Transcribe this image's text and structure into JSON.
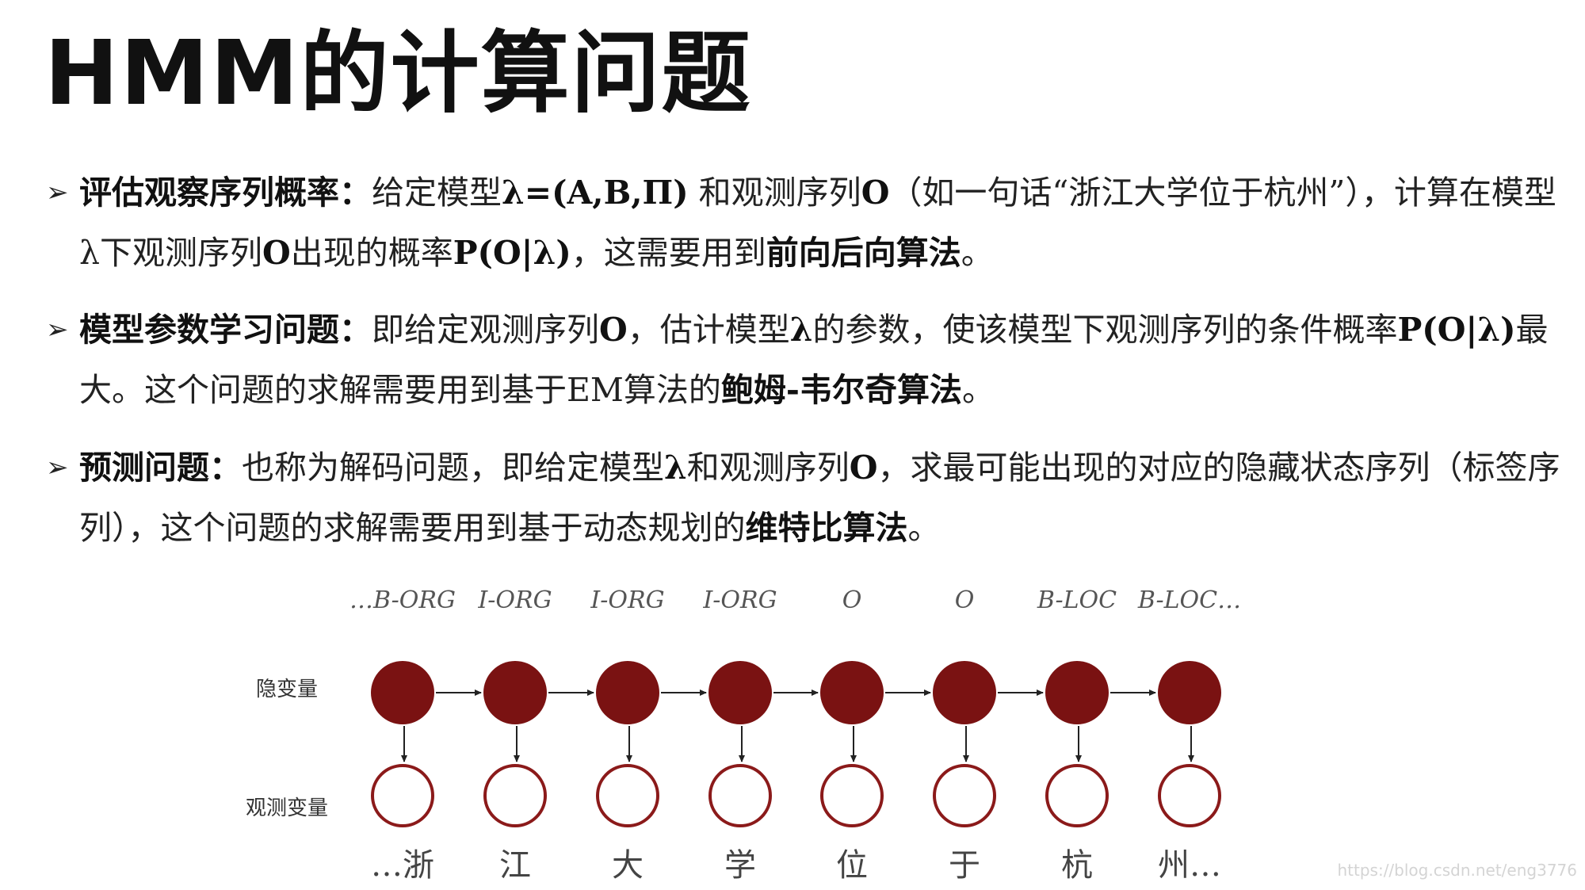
{
  "title": "HMM的计算问题",
  "bullets": [
    {
      "head": "评估观察序列概率：",
      "parts": [
        {
          "t": "给定模型",
          "bold": false
        },
        {
          "t": "λ=(A,B,Π)",
          "bold": true
        },
        {
          "t": " 和观测序列",
          "bold": false
        },
        {
          "t": "O",
          "bold": true
        },
        {
          "t": "（如一句话“浙江大学位于杭州”），计算在模型",
          "bold": false
        },
        {
          "t": "λ",
          "bold": false
        },
        {
          "t": "下观测序列",
          "bold": false
        },
        {
          "t": "O",
          "bold": true
        },
        {
          "t": "出现的概率",
          "bold": false
        },
        {
          "t": "P(O|λ)",
          "bold": true
        },
        {
          "t": "，这需要用到",
          "bold": false
        },
        {
          "t": "前向后向算法",
          "bold": true
        },
        {
          "t": "。",
          "bold": false
        }
      ]
    },
    {
      "head": "模型参数学习问题：",
      "parts": [
        {
          "t": "即给定观测序列",
          "bold": false
        },
        {
          "t": "O",
          "bold": true
        },
        {
          "t": "，估计模型",
          "bold": false
        },
        {
          "t": "λ",
          "bold": true
        },
        {
          "t": "的参数，使该模型下观测序列的条件概率",
          "bold": false
        },
        {
          "t": "P(O|λ)",
          "bold": true
        },
        {
          "t": "最大。这个问题的求解需要用到基于EM算法的",
          "bold": false
        },
        {
          "t": "鲍姆-韦尔奇算法",
          "bold": true
        },
        {
          "t": "。",
          "bold": false
        }
      ]
    },
    {
      "head": "预测问题：",
      "parts": [
        {
          "t": "也称为解码问题，即给定模型",
          "bold": false
        },
        {
          "t": "λ",
          "bold": true
        },
        {
          "t": "和观测序列",
          "bold": false
        },
        {
          "t": "O",
          "bold": true
        },
        {
          "t": "，求最可能出现的对应的隐藏状态序列（标签序列），这个问题的求解需要用到基于动态规划的",
          "bold": false
        },
        {
          "t": "维特比算法",
          "bold": true
        },
        {
          "t": "。",
          "bold": false
        }
      ]
    }
  ],
  "diagram": {
    "hidden_label": "隐变量",
    "observed_label": "观测变量",
    "tags": [
      "…B-ORG",
      "I-ORG",
      "I-ORG",
      "I-ORG",
      "O",
      "O",
      "B-LOC",
      "B-LOC…"
    ],
    "chars": [
      "…浙",
      "江",
      "大",
      "学",
      "位",
      "于",
      "杭",
      "州…"
    ],
    "hidden_color": "#7a1212",
    "observed_stroke": "#8b1a1a"
  },
  "watermark": "https://blog.csdn.net/eng3776"
}
